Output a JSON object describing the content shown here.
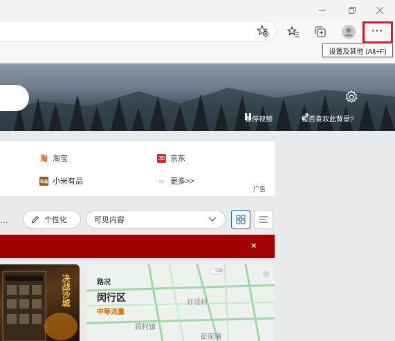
{
  "tooltip": {
    "text": "设置及其他 (Alt+F)"
  },
  "hero": {
    "pause_label": "暂停视频",
    "like_bg_label": "是否喜欢此背景?"
  },
  "quicklinks": {
    "items": [
      {
        "label": "淘宝",
        "icon": "taobao-icon",
        "color": "#ff5000"
      },
      {
        "label": "京东",
        "icon": "jd-icon",
        "color": "#e1251b"
      },
      {
        "label": "小米有品",
        "icon": "youpin-icon",
        "color": "#8a5a2b"
      },
      {
        "label": "更多>>",
        "icon": "more-sites-icon",
        "color": "#999999"
      }
    ],
    "ad_label": "广告"
  },
  "controls": {
    "ellipsis": "…",
    "personalize_label": "个性化",
    "visible_content_label": "可见内容"
  },
  "redbar": {
    "close": "×"
  },
  "traffic_card": {
    "title": "路况",
    "district": "闵行区",
    "status": "中等流量",
    "map_labels": [
      "许泾村",
      "顾村镇",
      "彭家埔",
      "S20"
    ]
  },
  "game_card": {
    "title_chars": "决战沙城"
  },
  "colors": {
    "accent": "#0067c0",
    "highlight_border": "#e81123",
    "alert_red": "#a30000",
    "traffic_orange": "#d9700a"
  }
}
